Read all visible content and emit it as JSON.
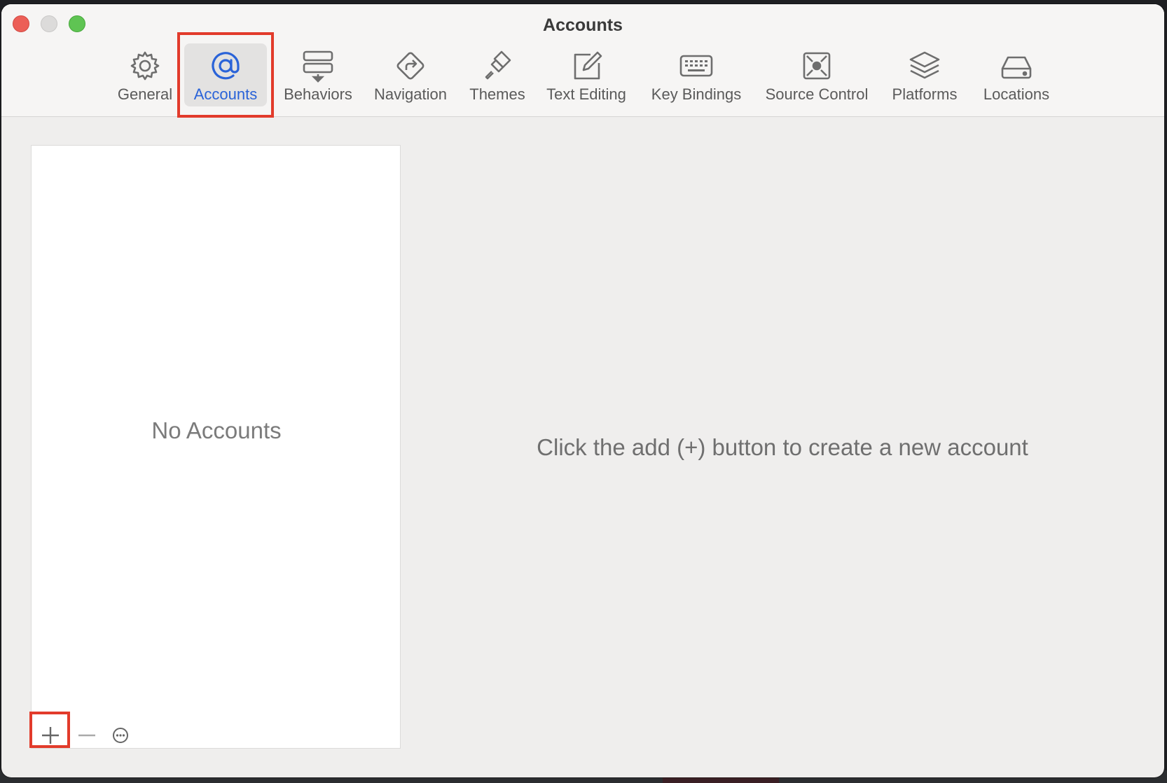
{
  "window": {
    "title": "Accounts"
  },
  "toolbar": {
    "items": [
      {
        "label": "General",
        "icon": "gear-icon"
      },
      {
        "label": "Accounts",
        "icon": "at-sign-icon",
        "selected": true
      },
      {
        "label": "Behaviors",
        "icon": "behaviors-icon"
      },
      {
        "label": "Navigation",
        "icon": "navigation-icon"
      },
      {
        "label": "Themes",
        "icon": "paintbrush-icon"
      },
      {
        "label": "Text Editing",
        "icon": "pencil-square-icon"
      },
      {
        "label": "Key Bindings",
        "icon": "keyboard-icon"
      },
      {
        "label": "Source Control",
        "icon": "source-control-icon"
      },
      {
        "label": "Platforms",
        "icon": "layers-icon"
      },
      {
        "label": "Locations",
        "icon": "drive-icon"
      }
    ]
  },
  "accounts_list": {
    "empty_text": "No Accounts",
    "add_icon": "plus-icon",
    "remove_icon": "minus-icon",
    "more_icon": "ellipsis-circle-icon"
  },
  "detail": {
    "message": "Click the add (+) button to create a new account"
  },
  "colors": {
    "accent": "#2a63d8",
    "annotation": "#e23b2b",
    "close": "#ec5f57",
    "zoom": "#5fc453"
  }
}
